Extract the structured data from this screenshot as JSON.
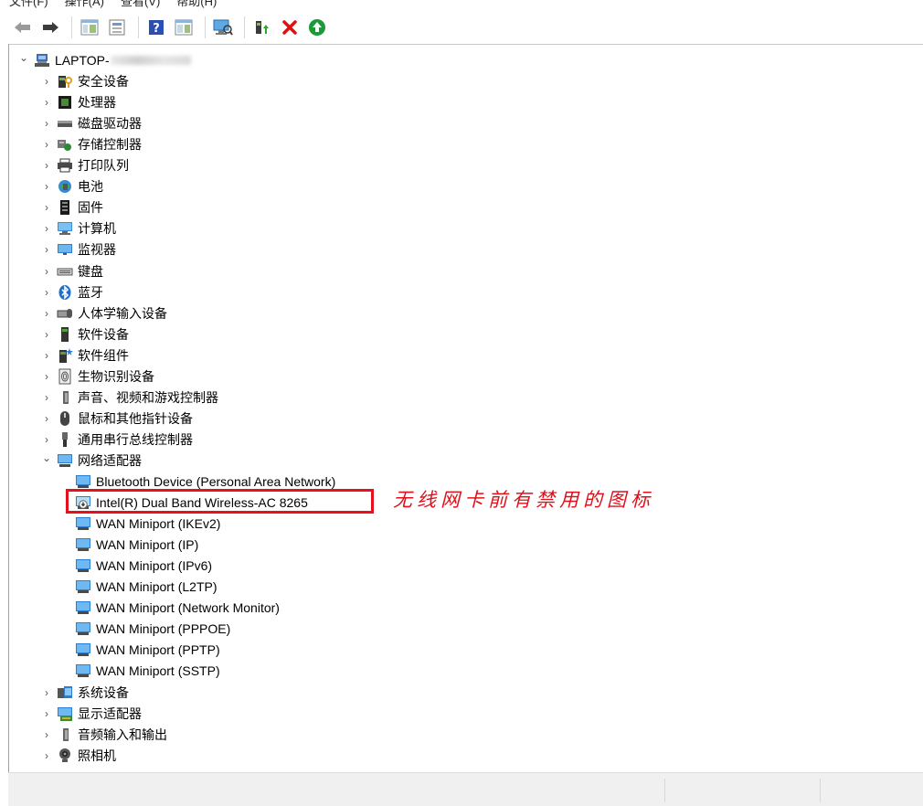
{
  "menu": {
    "items": [
      "文件(F)",
      "操作(A)",
      "查看(V)",
      "帮助(H)"
    ]
  },
  "toolbar": {
    "buttons": [
      {
        "name": "back-arrow-icon"
      },
      {
        "name": "forward-arrow-icon"
      },
      {
        "name": "show-hide-console-tree-icon"
      },
      {
        "name": "properties-icon"
      },
      {
        "name": "help-icon"
      },
      {
        "name": "action-pane-icon"
      },
      {
        "name": "scan-hardware-icon"
      },
      {
        "name": "update-driver-icon"
      },
      {
        "name": "uninstall-device-icon"
      },
      {
        "name": "enable-device-icon"
      }
    ]
  },
  "tree": {
    "root": {
      "label": "LAPTOP-",
      "icon": "computer-root-icon"
    },
    "categories": [
      {
        "label": "安全设备",
        "icon": "security-device-icon"
      },
      {
        "label": "处理器",
        "icon": "processor-icon"
      },
      {
        "label": "磁盘驱动器",
        "icon": "disk-drive-icon"
      },
      {
        "label": "存储控制器",
        "icon": "storage-controller-icon"
      },
      {
        "label": "打印队列",
        "icon": "print-queue-icon"
      },
      {
        "label": "电池",
        "icon": "battery-icon"
      },
      {
        "label": "固件",
        "icon": "firmware-icon"
      },
      {
        "label": "计算机",
        "icon": "computer-icon"
      },
      {
        "label": "监视器",
        "icon": "monitor-icon"
      },
      {
        "label": "键盘",
        "icon": "keyboard-icon"
      },
      {
        "label": "蓝牙",
        "icon": "bluetooth-icon"
      },
      {
        "label": "人体学输入设备",
        "icon": "hid-icon"
      },
      {
        "label": "软件设备",
        "icon": "software-device-icon"
      },
      {
        "label": "软件组件",
        "icon": "software-component-icon"
      },
      {
        "label": "生物识别设备",
        "icon": "biometric-icon"
      },
      {
        "label": "声音、视频和游戏控制器",
        "icon": "sound-icon"
      },
      {
        "label": "鼠标和其他指针设备",
        "icon": "mouse-icon"
      },
      {
        "label": "通用串行总线控制器",
        "icon": "usb-icon"
      },
      {
        "label": "网络适配器",
        "icon": "network-adapter-icon",
        "expanded": true
      }
    ],
    "network_adapters": [
      {
        "label": "Bluetooth Device (Personal Area Network)"
      },
      {
        "label": "Intel(R) Dual Band Wireless-AC 8265",
        "disabled": true
      },
      {
        "label": "WAN Miniport (IKEv2)"
      },
      {
        "label": "WAN Miniport (IP)"
      },
      {
        "label": "WAN Miniport (IPv6)"
      },
      {
        "label": "WAN Miniport (L2TP)"
      },
      {
        "label": "WAN Miniport (Network Monitor)"
      },
      {
        "label": "WAN Miniport (PPPOE)"
      },
      {
        "label": "WAN Miniport (PPTP)"
      },
      {
        "label": "WAN Miniport (SSTP)"
      }
    ],
    "after": [
      {
        "label": "系统设备",
        "icon": "system-device-icon"
      },
      {
        "label": "显示适配器",
        "icon": "display-adapter-icon"
      },
      {
        "label": "音频输入和输出",
        "icon": "audio-io-icon"
      },
      {
        "label": "照相机",
        "icon": "camera-icon"
      }
    ]
  },
  "annotation": {
    "text": "无线网卡前有禁用的图标"
  },
  "colors": {
    "annotation": "#e0101a",
    "highlight_border": "#e8101a",
    "nic_icon": "#2a7fd4"
  }
}
